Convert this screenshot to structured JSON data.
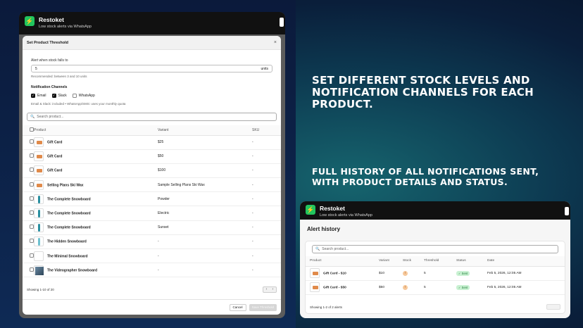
{
  "left_app": {
    "name": "Restoket",
    "subtitle": "Low stock alerts via WhatsApp"
  },
  "modal": {
    "title": "Set Product Threshold",
    "close": "×",
    "threshold_label": "Alert when stock falls to",
    "threshold_value": "5",
    "threshold_unit": "units",
    "recommended": "Recommended: between 3 and 10 units",
    "channels_title": "Notification Channels",
    "channels": [
      {
        "label": "Email",
        "checked": true
      },
      {
        "label": "Slack",
        "checked": true
      },
      {
        "label": "WhatsApp",
        "checked": false
      }
    ],
    "channels_note": "Email & Slack: included • WhatsApp/SMS: uses your monthly quota",
    "search_placeholder": "Search product...",
    "columns": [
      "Product",
      "Variant",
      "SKU"
    ],
    "rows": [
      {
        "product": "Gift Card",
        "variant": "$25",
        "sku": "-",
        "thumb": "card"
      },
      {
        "product": "Gift Card",
        "variant": "$50",
        "sku": "-",
        "thumb": "card"
      },
      {
        "product": "Gift Card",
        "variant": "$100",
        "sku": "-",
        "thumb": "card"
      },
      {
        "product": "Selling Plans Ski Wax",
        "variant": "Sample Selling Plans Ski Wax",
        "sku": "-",
        "thumb": "card"
      },
      {
        "product": "The Complete Snowboard",
        "variant": "Powder",
        "sku": "-",
        "thumb": "board"
      },
      {
        "product": "The Complete Snowboard",
        "variant": "Electric",
        "sku": "-",
        "thumb": "board"
      },
      {
        "product": "The Complete Snowboard",
        "variant": "Sunset",
        "sku": "-",
        "thumb": "board"
      },
      {
        "product": "The Hidden Snowboard",
        "variant": "-",
        "sku": "-",
        "thumb": "board2"
      },
      {
        "product": "The Minimal Snowboard",
        "variant": "-",
        "sku": "-",
        "thumb": "blank"
      },
      {
        "product": "The Videographer Snowboard",
        "variant": "-",
        "sku": "-",
        "thumb": "photo"
      }
    ],
    "showing": "Showing 1-10 of 20",
    "cancel": "Cancel",
    "save": "Save Threshold"
  },
  "headlines": {
    "first": "Set different stock levels and notification channels for each product.",
    "second": "Full history of all notifications sent, with product details and status."
  },
  "right_app": {
    "name": "Restoket",
    "subtitle": "Low stock alerts via WhatsApp",
    "page_title": "Alert history",
    "search_placeholder": "Search product...",
    "columns": [
      "Product",
      "Variant",
      "Stock",
      "Threshold",
      "Status",
      "Date"
    ],
    "rows": [
      {
        "product": "Gift Card - $10",
        "variant": "$10",
        "stock": "!",
        "threshold": "5",
        "status": "✓ Sent",
        "date": "Feb 5, 2026, 12:05 AM"
      },
      {
        "product": "Gift Card - $50",
        "variant": "$50",
        "stock": "!",
        "threshold": "5",
        "status": "✓ Sent",
        "date": "Feb 5, 2026, 12:05 AM"
      }
    ],
    "showing": "Showing 1-2 of 2 alerts"
  },
  "colors": {
    "brand": "#22c55e",
    "sent_badge": "#c9f1d2"
  }
}
